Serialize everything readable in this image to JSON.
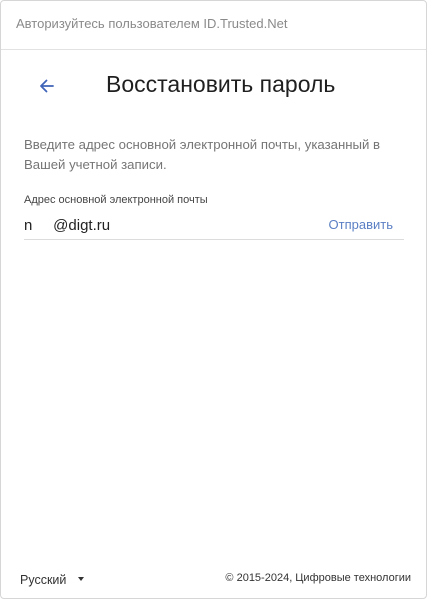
{
  "header": {
    "title": "Авторизуйтесь пользователем ID.Trusted.Net"
  },
  "page": {
    "back_icon": "arrow-left-icon",
    "title": "Восстановить пароль",
    "description": "Введите адрес основной электронной почты, указанный в Вашей учетной записи."
  },
  "form": {
    "email_label": "Адрес основной электронной почты",
    "email_value": "n     @digt.ru",
    "send_label": "Отправить"
  },
  "footer": {
    "language": "Русский",
    "language_icon": "caret-down-icon",
    "copyright": "© 2015-2024, Цифровые технологии"
  },
  "colors": {
    "accent": "#5b7fc4",
    "title_text": "#1f1f1f",
    "muted_text": "#757575"
  }
}
